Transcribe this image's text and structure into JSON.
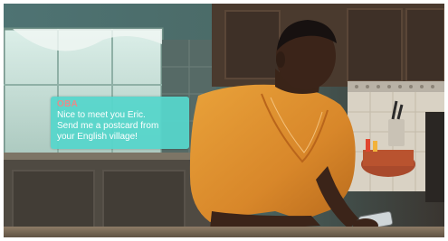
{
  "notification": {
    "sender": "OBA",
    "message": "Nice to meet you Eric.\nSend me a postcard from\nyour English village!"
  },
  "colors": {
    "bubble": "#56d6cb",
    "sender": "#e88a8a",
    "message_text": "#ffffff"
  }
}
